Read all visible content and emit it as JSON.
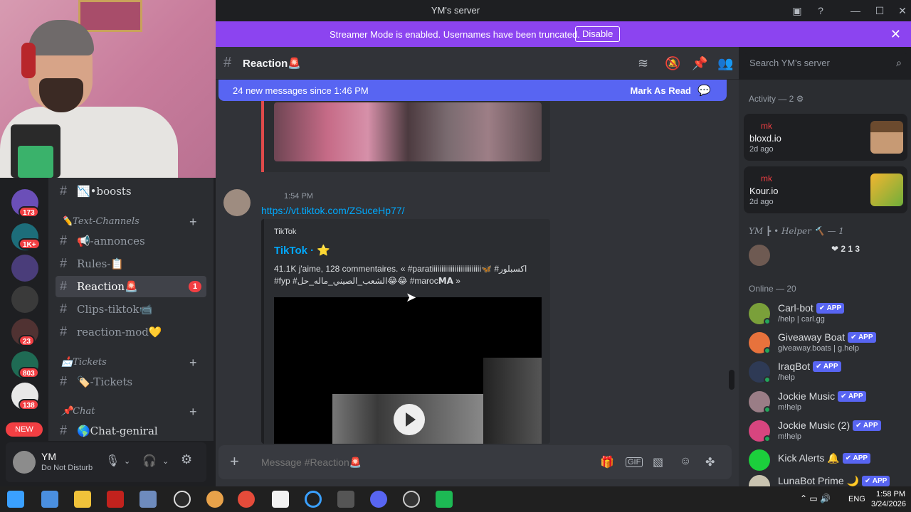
{
  "window": {
    "title": "YM's server"
  },
  "banner": {
    "text": "Streamer Mode is enabled. Usernames have been truncated.",
    "disable_label": "Disable",
    "color": "#8c44f0"
  },
  "servers": {
    "badges": [
      "173",
      "1K+",
      "23",
      "803",
      "138"
    ],
    "new_label": "NEW"
  },
  "sidebar": {
    "channels": [
      {
        "label": "📉•boosts"
      },
      {
        "label": "📢-annonces"
      },
      {
        "label": "Rules-📋"
      },
      {
        "label": "Reaction🚨",
        "unread": "1"
      },
      {
        "label": "Clips-tiktok📹"
      },
      {
        "label": "reaction-mod💛"
      },
      {
        "label": "🏷️-Tickets"
      },
      {
        "label": "🌎Chat-geniral"
      }
    ],
    "categories": [
      "✏️Text-Channels",
      "📩Tickets",
      "📌Chat"
    ]
  },
  "user": {
    "name": "YM",
    "status": "Do Not Disturb"
  },
  "chat": {
    "channel": "Reaction🚨",
    "new_messages": "24 new messages since 1:46 PM",
    "mark_as_read": "Mark As Read",
    "message": {
      "time": "1:54 PM",
      "link": "https://vt.tiktok.com/ZSuceHp77/",
      "embed": {
        "provider": "TikTok",
        "title": "TikTok · ⭐",
        "description": "41.1K j'aime, 128 commentaires. « #paratiiiiiiiiiiiiiiiiiiiiiiiiii🦋 #اكسبلور #fyp #الشعب_الصيني_ماله_حل😂😂 #maroc𝗠𝗔 »"
      }
    },
    "composer_placeholder": "Message #Reaction🚨"
  },
  "search": {
    "placeholder": "Search YM's server"
  },
  "members": {
    "activity_header": "Activity — 2 ⚙",
    "activities": [
      {
        "name": "mk",
        "game": "bloxd.io",
        "time": "2d ago"
      },
      {
        "name": "mk",
        "game": "Kour.io",
        "time": "2d ago"
      }
    ],
    "helper_header": "YM ┣ • Helper 🔨 — 1",
    "helper_tag": "❤ 2 1 3",
    "online_header": "Online — 20",
    "online": [
      {
        "name": "Carl-bot",
        "sub": "/help | carl.gg"
      },
      {
        "name": "Giveaway Boat",
        "sub": "giveaway.boats | g.help"
      },
      {
        "name": "IraqBot",
        "sub": "/help"
      },
      {
        "name": "Jockie Music",
        "sub": "m!help"
      },
      {
        "name": "Jockie Music (2)",
        "sub": "m!help"
      },
      {
        "name": "Kick Alerts 🔔",
        "sub": ""
      },
      {
        "name": "LunaBot Prime 🌙",
        "sub": ""
      }
    ],
    "app_label": "✔ APP"
  },
  "taskbar": {
    "lang": "ENG",
    "time": "1:58 PM",
    "date": "3/24/2026"
  }
}
